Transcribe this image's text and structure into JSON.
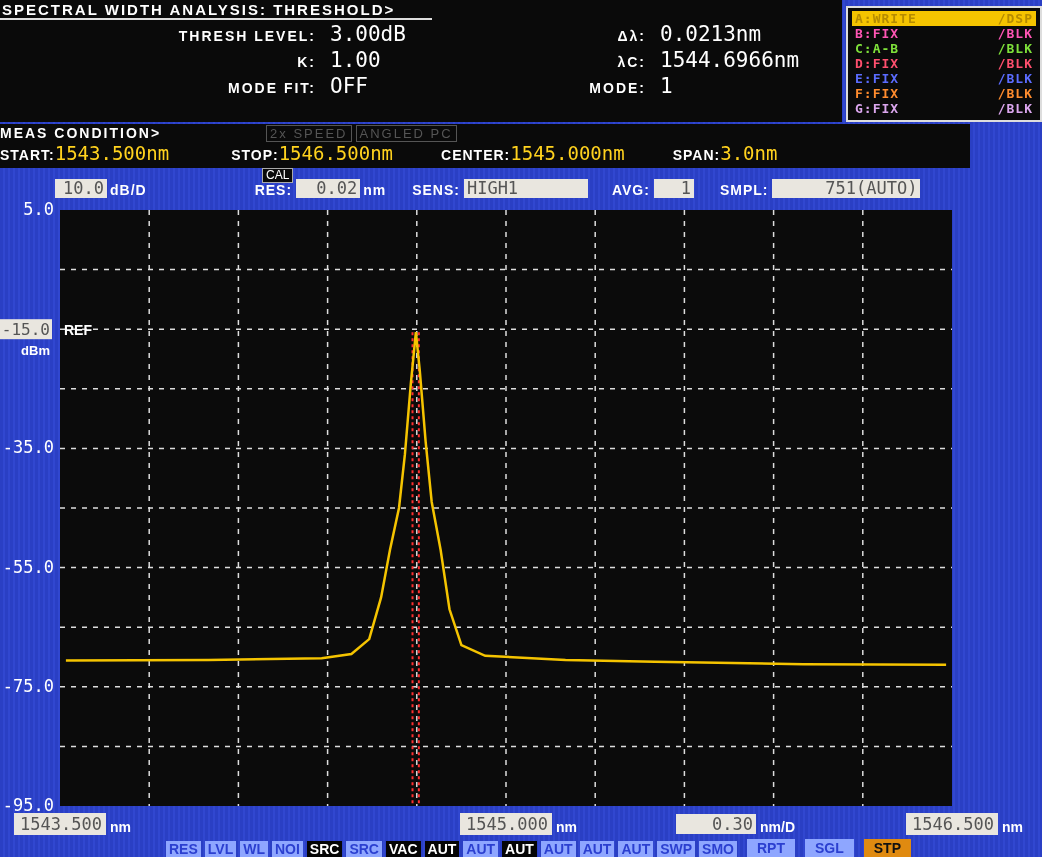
{
  "analysis": {
    "title": "SPECTRAL WIDTH ANALYSIS: THRESHOLD>",
    "left_fields": [
      {
        "label": "THRESH LEVEL:",
        "value": "3.00dB"
      },
      {
        "label": "K:",
        "value": "1.00"
      },
      {
        "label": "MODE FIT:",
        "value": "OFF"
      }
    ],
    "right_fields": [
      {
        "label": "Δλ:",
        "value": "0.0213nm"
      },
      {
        "label": "λC:",
        "value": "1544.6966nm"
      },
      {
        "label": "MODE:",
        "value": "1"
      }
    ]
  },
  "traces": [
    {
      "label": "A:WRITE",
      "display": "/DSP",
      "color": "#f5c400",
      "selected": true
    },
    {
      "label": "B:FIX",
      "display": "/BLK",
      "color": "#ff55b4",
      "selected": false
    },
    {
      "label": "C:A-B",
      "display": "/BLK",
      "color": "#7ee03a",
      "selected": false
    },
    {
      "label": "D:FIX",
      "display": "/BLK",
      "color": "#ff4f6e",
      "selected": false
    },
    {
      "label": "E:FIX",
      "display": "/BLK",
      "color": "#5b6cff",
      "selected": false
    },
    {
      "label": "F:FIX",
      "display": "/BLK",
      "color": "#ff8c2e",
      "selected": false
    },
    {
      "label": "G:FIX",
      "display": "/BLK",
      "color": "#dba6ee",
      "selected": false
    }
  ],
  "meas_condition": {
    "title": "MEAS CONDITION>",
    "indicators": [
      "2x SPEED",
      "ANGLED PC"
    ],
    "fields": [
      {
        "label": "START:",
        "value": "1543.500nm"
      },
      {
        "label": "STOP:",
        "value": "1546.500nm"
      },
      {
        "label": "CENTER:",
        "value": "1545.000nm"
      },
      {
        "label": "SPAN:",
        "value": "3.0nm"
      }
    ]
  },
  "settings": {
    "scale": {
      "value": "10.0",
      "unit": "dB/D"
    },
    "cal": "CAL",
    "res": {
      "label": "RES:",
      "value": "0.02",
      "unit": "nm"
    },
    "sens": {
      "label": "SENS:",
      "value": "HIGH1"
    },
    "avg": {
      "label": "AVG:",
      "value": "1"
    },
    "smpl": {
      "label": "SMPL:",
      "value": "751(AUTO)"
    }
  },
  "reference": {
    "value": "-15.0",
    "unit": "dBm",
    "label": "REF"
  },
  "chart_data": {
    "type": "line",
    "xlim": [
      1543.5,
      1546.5
    ],
    "ylim": [
      -95,
      5
    ],
    "xticks": [
      {
        "value": 1543.5,
        "label": "1543.500"
      },
      {
        "value": 1545.0,
        "label": "1545.000"
      },
      {
        "value": 1546.5,
        "label": "1546.500"
      }
    ],
    "grid": true,
    "ref_lines": [
      {
        "axis": "x",
        "value": 1544.6856,
        "color": "#ff3030"
      },
      {
        "axis": "x",
        "value": 1544.7069,
        "color": "#ff3030"
      }
    ],
    "yticks": [
      {
        "value": 5,
        "label": "5.0"
      },
      {
        "value": -35,
        "label": "-35.0"
      },
      {
        "value": -55,
        "label": "-55.0"
      },
      {
        "value": -75,
        "label": "-75.0"
      },
      {
        "value": -95,
        "label": "-95.0"
      }
    ],
    "x": [
      1543.52,
      1544.0,
      1544.38,
      1544.48,
      1544.54,
      1544.58,
      1544.61,
      1544.64,
      1544.66,
      1544.68,
      1544.697,
      1544.71,
      1544.73,
      1544.75,
      1544.78,
      1544.81,
      1544.85,
      1544.93,
      1545.2,
      1545.5,
      1546.0,
      1546.48
    ],
    "series": [
      {
        "color": "#f5c400",
        "values": [
          -70.6,
          -70.5,
          -70.2,
          -69.5,
          -67,
          -60,
          -52,
          -45,
          -36,
          -24,
          -15.5,
          -22,
          -34,
          -44,
          -52,
          -62,
          -68,
          -69.8,
          -70.5,
          -70.8,
          -71.2,
          -71.3
        ]
      }
    ]
  },
  "x_tick_units": [
    "nm",
    "nm",
    "nm"
  ],
  "x_scale": {
    "value": "0.30",
    "unit": "nm/D"
  },
  "soft_keys": [
    {
      "label": "RES",
      "selected": false
    },
    {
      "label": "LVL",
      "selected": false
    },
    {
      "label": "WL",
      "selected": false
    },
    {
      "label": "NOI",
      "selected": false
    },
    {
      "label": "SRC",
      "selected": true
    },
    {
      "label": "SRC",
      "selected": false
    },
    {
      "label": "VAC",
      "selected": true
    },
    {
      "label": "AUT",
      "selected": true
    },
    {
      "label": "AUT",
      "selected": false
    },
    {
      "label": "AUT",
      "selected": true
    },
    {
      "label": "AUT",
      "selected": false
    },
    {
      "label": "AUT",
      "selected": false
    },
    {
      "label": "AUT",
      "selected": false
    },
    {
      "label": "SWP",
      "selected": false
    },
    {
      "label": "SMO",
      "selected": false
    }
  ],
  "sweep_keys": [
    {
      "label": "RPT",
      "selected": false
    },
    {
      "label": "SGL",
      "selected": false
    },
    {
      "label": "STP",
      "selected": true
    }
  ]
}
